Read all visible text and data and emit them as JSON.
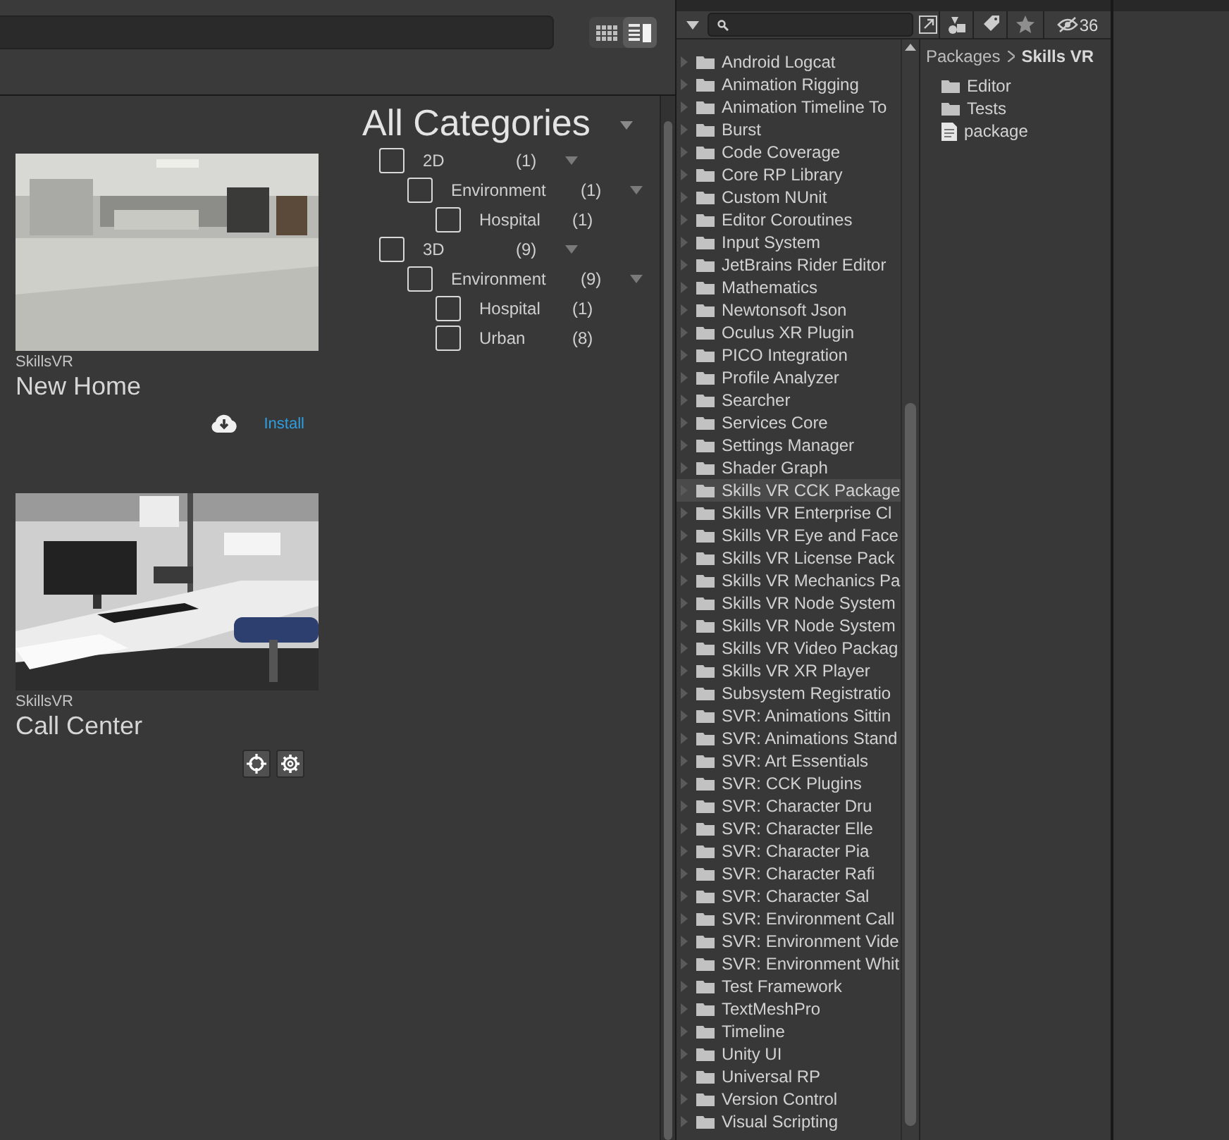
{
  "store": {
    "view_toggle": [
      {
        "kind": "grid",
        "selected": false
      },
      {
        "kind": "list",
        "selected": true
      }
    ],
    "cards": [
      {
        "publisher": "SkillsVR",
        "title": "New Home",
        "action": {
          "kind": "install",
          "label": "Install"
        }
      },
      {
        "publisher": "SkillsVR",
        "title": "Call Center",
        "action": {
          "kind": "manage"
        }
      }
    ],
    "categories": {
      "title": "All Categories",
      "items": [
        {
          "label": "2D",
          "count": "(1)",
          "checked": false,
          "expanded": true,
          "children": [
            {
              "label": "Environment",
              "count": "(1)",
              "checked": false,
              "expanded": true,
              "children": [
                {
                  "label": "Hospital",
                  "count": "(1)",
                  "checked": false
                }
              ]
            }
          ]
        },
        {
          "label": "3D",
          "count": "(9)",
          "checked": false,
          "expanded": true,
          "children": [
            {
              "label": "Environment",
              "count": "(9)",
              "checked": false,
              "expanded": true,
              "children": [
                {
                  "label": "Hospital",
                  "count": "(1)",
                  "checked": false
                },
                {
                  "label": "Urban",
                  "count": "(8)",
                  "checked": false
                }
              ]
            }
          ]
        }
      ]
    }
  },
  "project": {
    "hidden_count": "36",
    "breadcrumb": [
      "Packages",
      "Skills VR"
    ],
    "tree": [
      {
        "label": "Android Logcat",
        "selected": false
      },
      {
        "label": "Animation Rigging",
        "selected": false
      },
      {
        "label": "Animation Timeline To",
        "selected": false
      },
      {
        "label": "Burst",
        "selected": false
      },
      {
        "label": "Code Coverage",
        "selected": false
      },
      {
        "label": "Core RP Library",
        "selected": false
      },
      {
        "label": "Custom NUnit",
        "selected": false
      },
      {
        "label": "Editor Coroutines",
        "selected": false
      },
      {
        "label": "Input System",
        "selected": false
      },
      {
        "label": "JetBrains Rider Editor",
        "selected": false
      },
      {
        "label": "Mathematics",
        "selected": false
      },
      {
        "label": "Newtonsoft Json",
        "selected": false
      },
      {
        "label": "Oculus XR Plugin",
        "selected": false
      },
      {
        "label": "PICO Integration",
        "selected": false
      },
      {
        "label": "Profile Analyzer",
        "selected": false
      },
      {
        "label": "Searcher",
        "selected": false
      },
      {
        "label": "Services Core",
        "selected": false
      },
      {
        "label": "Settings Manager",
        "selected": false
      },
      {
        "label": "Shader Graph",
        "selected": false
      },
      {
        "label": "Skills VR CCK Package",
        "selected": true
      },
      {
        "label": "Skills VR Enterprise Cl",
        "selected": false
      },
      {
        "label": "Skills VR Eye and Face",
        "selected": false
      },
      {
        "label": "Skills VR License Pack",
        "selected": false
      },
      {
        "label": "Skills VR Mechanics Pa",
        "selected": false
      },
      {
        "label": "Skills VR Node System",
        "selected": false
      },
      {
        "label": "Skills VR Node System",
        "selected": false
      },
      {
        "label": "Skills VR Video Packag",
        "selected": false
      },
      {
        "label": "Skills VR XR Player",
        "selected": false
      },
      {
        "label": "Subsystem Registratio",
        "selected": false
      },
      {
        "label": "SVR: Animations Sittin",
        "selected": false
      },
      {
        "label": "SVR: Animations Stand",
        "selected": false
      },
      {
        "label": "SVR: Art Essentials",
        "selected": false
      },
      {
        "label": "SVR: CCK Plugins",
        "selected": false
      },
      {
        "label": "SVR: Character Dru",
        "selected": false
      },
      {
        "label": "SVR: Character Elle",
        "selected": false
      },
      {
        "label": "SVR: Character Pia",
        "selected": false
      },
      {
        "label": "SVR: Character Rafi",
        "selected": false
      },
      {
        "label": "SVR: Character Sal",
        "selected": false
      },
      {
        "label": "SVR: Environment Call",
        "selected": false
      },
      {
        "label": "SVR: Environment Vide",
        "selected": false
      },
      {
        "label": "SVR: Environment Whit",
        "selected": false
      },
      {
        "label": "Test Framework",
        "selected": false
      },
      {
        "label": "TextMeshPro",
        "selected": false
      },
      {
        "label": "Timeline",
        "selected": false
      },
      {
        "label": "Unity UI",
        "selected": false
      },
      {
        "label": "Universal RP",
        "selected": false
      },
      {
        "label": "Version Control",
        "selected": false
      },
      {
        "label": "Visual Scripting",
        "selected": false
      }
    ],
    "contents": [
      {
        "kind": "folder",
        "label": "Editor"
      },
      {
        "kind": "folder",
        "label": "Tests"
      },
      {
        "kind": "file",
        "label": "package"
      }
    ]
  }
}
